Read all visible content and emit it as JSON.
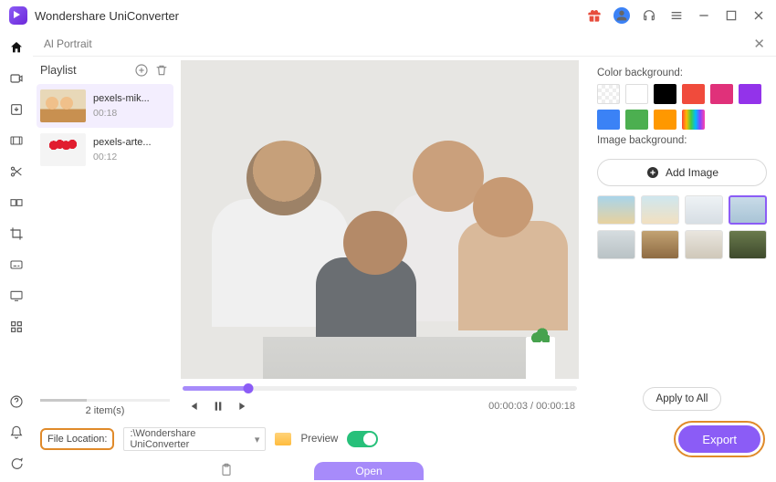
{
  "titlebar": {
    "app_name": "Wondershare UniConverter"
  },
  "panel": {
    "title": "Al Portrait"
  },
  "playlist": {
    "title": "Playlist",
    "items": [
      {
        "name": "pexels-mik...",
        "duration": "00:18"
      },
      {
        "name": "pexels-arte...",
        "duration": "00:12"
      }
    ],
    "count_label": "2 item(s)"
  },
  "transport": {
    "current": "00:00:03",
    "total": "00:00:18",
    "progress_pct": 16.7
  },
  "right": {
    "color_bg_label": "Color background:",
    "colors": [
      "transparent",
      "#ffffff",
      "#000000",
      "#f04b3c",
      "#e0317a",
      "#9333ea",
      "#3b82f6",
      "#4caf50",
      "#ff9800",
      "rainbow"
    ],
    "image_bg_label": "Image background:",
    "add_image_label": "Add Image",
    "apply_all_label": "Apply to All"
  },
  "footer": {
    "file_location_label": "File Location:",
    "file_path": ":\\Wondershare UniConverter",
    "preview_label": "Preview",
    "export_label": "Export",
    "open_label": "Open"
  }
}
